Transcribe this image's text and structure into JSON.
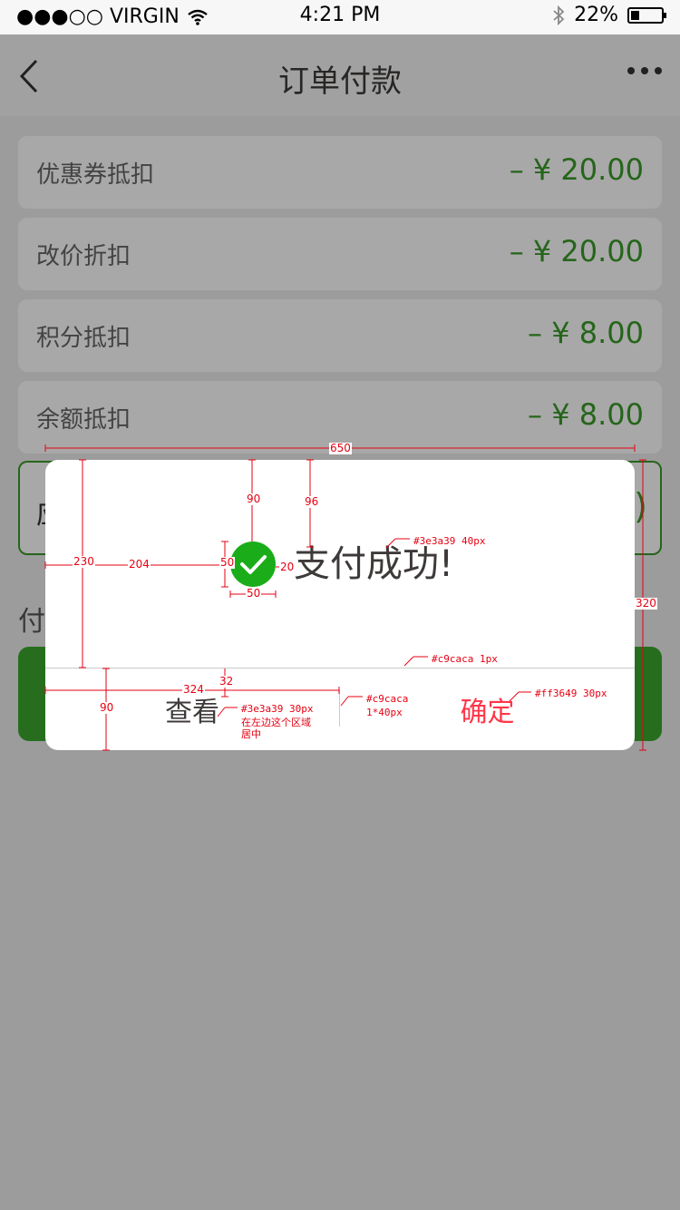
{
  "status_bar": {
    "carrier": "●●●○○ VIRGIN",
    "time": "4:21 PM",
    "battery": "22%",
    "battery_level": 0.22
  },
  "nav": {
    "title": "订单付款",
    "back_icon": "chevron-left-icon",
    "more_icon": "more-dots-icon"
  },
  "deductions": [
    {
      "label": "优惠券抵扣",
      "value": "– ¥ 20.00"
    },
    {
      "label": "改价折扣",
      "value": "– ¥ 20.00"
    },
    {
      "label": "积分抵扣",
      "value": "– ¥ 8.00"
    },
    {
      "label": "余额抵扣",
      "value": "– ¥ 8.00"
    }
  ],
  "due": {
    "label": "应",
    "value": ")"
  },
  "pay_label": "付",
  "dialog": {
    "title": "支付成功!",
    "view_button": "查看",
    "confirm_button": "确定",
    "icon": "check-circle-icon"
  },
  "colors": {
    "accent_green": "#3a9a2a",
    "success_green": "#1aad19",
    "text_dark": "#3e3a39",
    "divider": "#c9caca",
    "confirm_red": "#ff3649",
    "annotation_red": "#e60012"
  },
  "annotations": {
    "width_total": "650",
    "height_total": "320",
    "top_icon": "90",
    "top_text": "96",
    "left_offset": "204",
    "icon_size_v": "50",
    "icon_size_h": "50",
    "gap": "20",
    "body_height": "230",
    "footer_height": "90",
    "btn_width": "324",
    "divider_offset": "32",
    "title_spec": "#3e3a39   40px",
    "divider_spec": "#c9caca   1px",
    "view_spec": "#3e3a39   30px",
    "view_note_line1": "在左边这个区域",
    "view_note_line2": "居中",
    "vdivider_spec_line1": "#c9caca",
    "vdivider_spec_line2": "1*40px",
    "confirm_spec": "#ff3649    30px"
  }
}
